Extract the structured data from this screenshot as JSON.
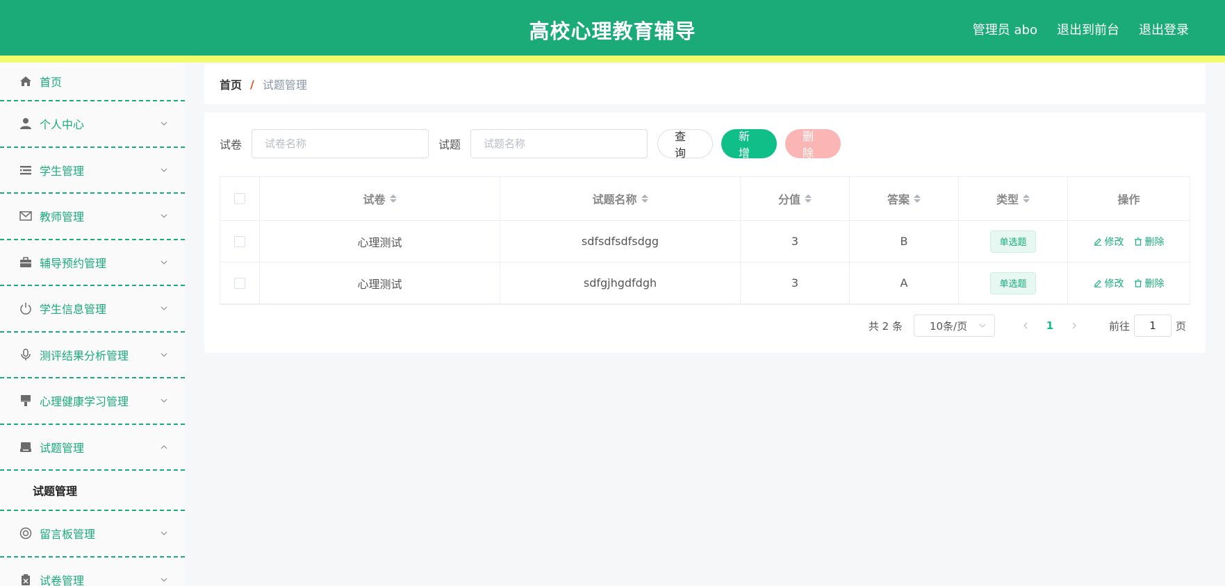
{
  "header": {
    "title": "高校心理教育辅导",
    "user_label": "管理员 abo",
    "to_frontend": "退出到前台",
    "logout": "退出登录"
  },
  "sidebar": {
    "items": [
      {
        "label": "首页",
        "icon": "home-icon"
      },
      {
        "label": "个人中心",
        "icon": "user-icon"
      },
      {
        "label": "学生管理",
        "icon": "list-icon"
      },
      {
        "label": "教师管理",
        "icon": "mail-icon"
      },
      {
        "label": "辅导预约管理",
        "icon": "briefcase-icon"
      },
      {
        "label": "学生信息管理",
        "icon": "power-icon"
      },
      {
        "label": "测评结果分析管理",
        "icon": "microphone-icon"
      },
      {
        "label": "心理健康学习管理",
        "icon": "paint-brush-icon"
      },
      {
        "label": "试题管理",
        "icon": "inbox-icon"
      },
      {
        "label": "留言板管理",
        "icon": "lifebuoy-icon"
      },
      {
        "label": "试卷管理",
        "icon": "clipboard-icon"
      }
    ],
    "submenu": {
      "label": "试题管理"
    }
  },
  "breadcrumb": {
    "home": "首页",
    "separator": "/",
    "current": "试题管理"
  },
  "search": {
    "paper_label": "试卷",
    "paper_placeholder": "试卷名称",
    "question_label": "试题",
    "question_placeholder": "试题名称",
    "query_button": "查询",
    "add_button": "新增",
    "delete_button": "删除"
  },
  "table": {
    "columns": [
      "试卷",
      "试题名称",
      "分值",
      "答案",
      "类型",
      "操作"
    ],
    "rows": [
      {
        "paper": "心理测试",
        "question": "sdfsdfsdfsdgg",
        "score": "3",
        "answer": "B",
        "type": "单选题"
      },
      {
        "paper": "心理测试",
        "question": "sdfgjhgdfdgh",
        "score": "3",
        "answer": "A",
        "type": "单选题"
      }
    ],
    "edit_label": "修改",
    "delete_label": "删除"
  },
  "pagination": {
    "total": "共 2 条",
    "page_size": "10条/页",
    "current_page": "1",
    "goto_label": "前往",
    "goto_value": "1",
    "page_suffix": "页"
  },
  "colors": {
    "primary": "#1aab79",
    "stripe": "#f1fb6c",
    "add": "#0fbf87",
    "delete": "#fbb5b5"
  }
}
